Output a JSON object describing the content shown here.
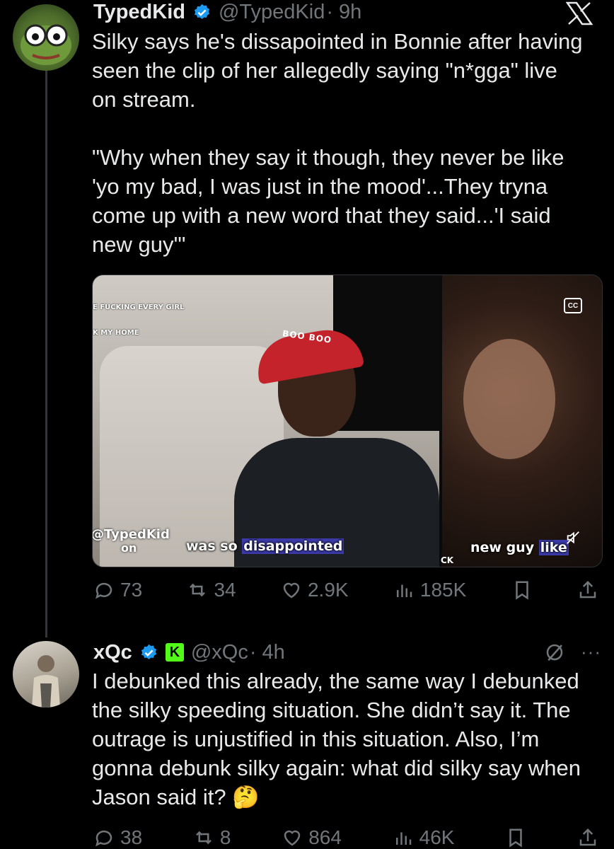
{
  "tweet1": {
    "display_name": "TypedKid",
    "handle": "@TypedKid",
    "time": "· 9h",
    "text": "Silky says he's dissapointed in Bonnie after having seen the clip of her allegedly saying \"n*gga\" live on stream.\n\n\"Why when they say it though, they never be like 'yo my bad, I was just in the mood'...They tryna come up with a new word that they said...'I said new guy'\"",
    "media": {
      "overlay_line_1": "E FUCKING EVERY GIRL",
      "overlay_line_2": "K MY HOME",
      "cap_text": "BOO BOO",
      "cc_label": "CC",
      "caption_left_prefix": "was so ",
      "caption_left_highlight": "disappointed",
      "caption_right_prefix": "new guy ",
      "caption_right_highlight": "like",
      "watermark": "@TypedKid",
      "watermark_sub": "on",
      "ck_label": "CK"
    },
    "actions": {
      "replies": "73",
      "reposts": "34",
      "likes": "2.9K",
      "views": "185K"
    }
  },
  "tweet2": {
    "display_name": "xQc",
    "handle": "@xQc",
    "time": "· 4h",
    "badge_letter": "K",
    "text": "I debunked this already, the same way I debunked the silky speeding situation. She didn’t say it. The outrage is unjustified in this situation. Also, I’m gonna debunk silky again: what did silky say when Jason said it? 🤔",
    "more_label": "···",
    "actions": {
      "replies": "38",
      "reposts": "8",
      "likes": "864",
      "views": "46K"
    }
  },
  "colors": {
    "background": "#000000",
    "text": "#e7e9ea",
    "muted": "#71767b",
    "verified": "#1d9bf0",
    "kick_green": "#53fc18"
  },
  "icons": [
    "x-logo-icon",
    "verified-icon",
    "reply-icon",
    "repost-icon",
    "like-icon",
    "views-icon",
    "bookmark-icon",
    "share-icon",
    "grok-icon",
    "more-icon",
    "mute-icon"
  ]
}
